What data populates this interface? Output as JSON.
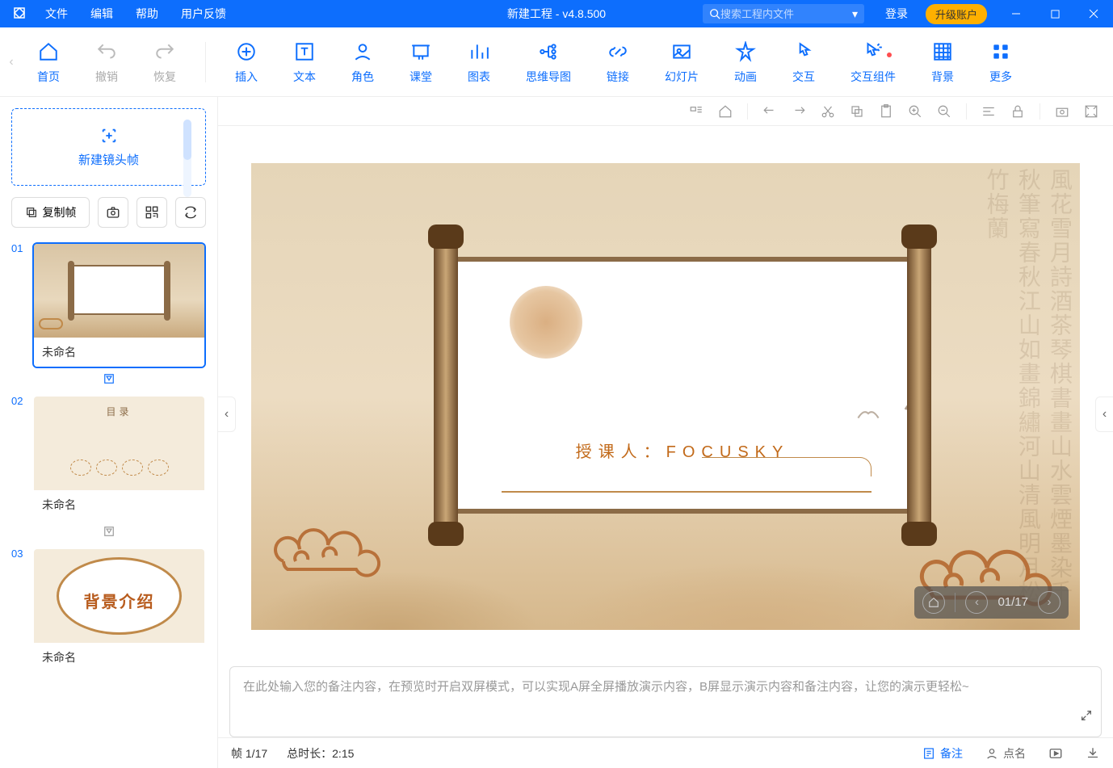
{
  "menu": {
    "file": "文件",
    "edit": "编辑",
    "help": "帮助",
    "feedback": "用户反馈"
  },
  "title": "新建工程 - v4.8.500",
  "search": {
    "placeholder": "搜索工程内文件"
  },
  "login": "登录",
  "upgrade": "升级账户",
  "toolbar": {
    "home": "首页",
    "undo": "撤销",
    "redo": "恢复",
    "insert": "插入",
    "text": "文本",
    "role": "角色",
    "class": "课堂",
    "chart": "图表",
    "mindmap": "思维导图",
    "link": "链接",
    "slide": "幻灯片",
    "animate": "动画",
    "interact": "交互",
    "component": "交互组件",
    "bg": "背景",
    "more": "更多"
  },
  "side": {
    "new_frame": "新建镜头帧",
    "copy": "复制帧"
  },
  "slides": {
    "s1": {
      "num": "01",
      "name": "未命名"
    },
    "s2": {
      "num": "02",
      "name": "未命名",
      "title": "目录"
    },
    "s3": {
      "num": "03",
      "name": "未命名",
      "title": "背景介绍"
    }
  },
  "canvas": {
    "lecturer": "授课人：FOCUSKY"
  },
  "nav": {
    "counter": "01/17"
  },
  "notes": {
    "placeholder": "在此处输入您的备注内容，在预览时开启双屏模式，可以实现A屏全屏播放演示内容，B屏显示演示内容和备注内容，让您的演示更轻松~"
  },
  "status": {
    "frame": "帧 1/17",
    "duration": "总时长：2:15",
    "note": "备注",
    "roll": "点名"
  }
}
